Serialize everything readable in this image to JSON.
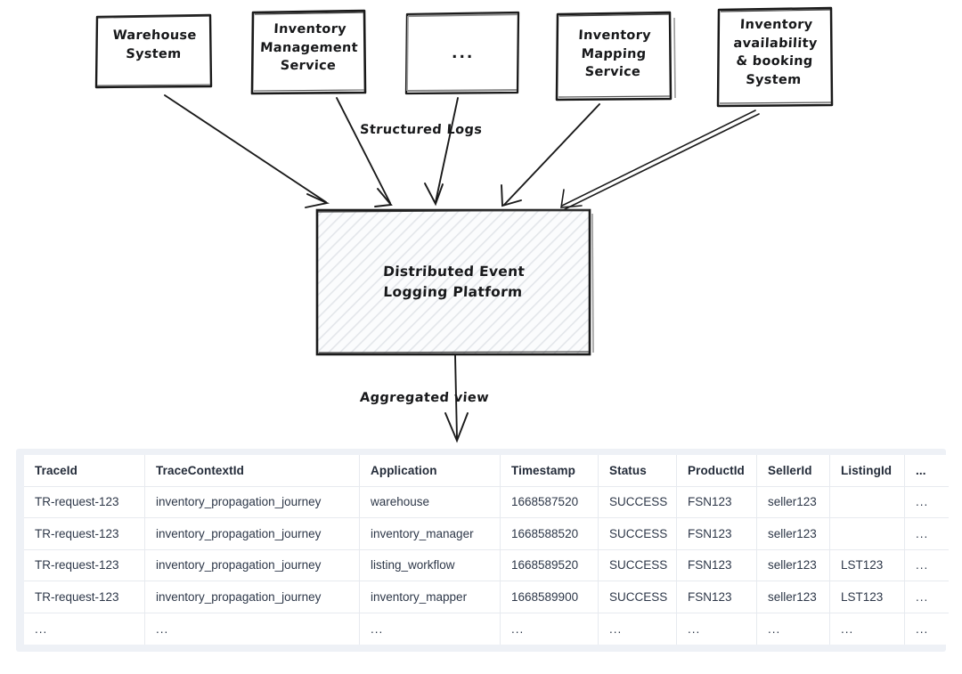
{
  "diagram": {
    "sources": [
      {
        "id": "warehouse-system",
        "label": "Warehouse\nSystem"
      },
      {
        "id": "inventory-management-service",
        "label": "Inventory\nManagement\nService"
      },
      {
        "id": "ellipsis-source",
        "label": "..."
      },
      {
        "id": "inventory-mapping-service",
        "label": "Inventory\nMapping\nService"
      },
      {
        "id": "inventory-availability-booking-system",
        "label": "Inventory\navailability\n& booking\nSystem"
      }
    ],
    "platform": {
      "label": "Distributed Event\nLogging Platform"
    },
    "edge_labels": {
      "ingest": "Structured Logs",
      "output": "Aggregated view"
    },
    "ink_color": "#1a1a1a"
  },
  "table": {
    "columns": [
      "TraceId",
      "TraceContextId",
      "Application",
      "Timestamp",
      "Status",
      "ProductId",
      "SellerId",
      "ListingId",
      "..."
    ],
    "rows": [
      [
        "TR-request-123",
        "inventory_propagation_journey",
        "warehouse",
        "1668587520",
        "SUCCESS",
        "FSN123",
        "seller123",
        "",
        "..."
      ],
      [
        "TR-request-123",
        "inventory_propagation_journey",
        "inventory_manager",
        "1668588520",
        "SUCCESS",
        "FSN123",
        "seller123",
        "",
        "..."
      ],
      [
        "TR-request-123",
        "inventory_propagation_journey",
        "listing_workflow",
        "1668589520",
        "SUCCESS",
        "FSN123",
        "seller123",
        "LST123",
        "..."
      ],
      [
        "TR-request-123",
        "inventory_propagation_journey",
        "inventory_mapper",
        "1668589900",
        "SUCCESS",
        "FSN123",
        "seller123",
        "LST123",
        "..."
      ],
      [
        "...",
        "...",
        "...",
        "...",
        "...",
        "...",
        "...",
        "...",
        "..."
      ]
    ],
    "panel_background": "#eef1f6",
    "cell_background": "#ffffff",
    "header_color": "#232b39",
    "cell_color": "#2d3748",
    "border_color": "#e7eaef"
  }
}
